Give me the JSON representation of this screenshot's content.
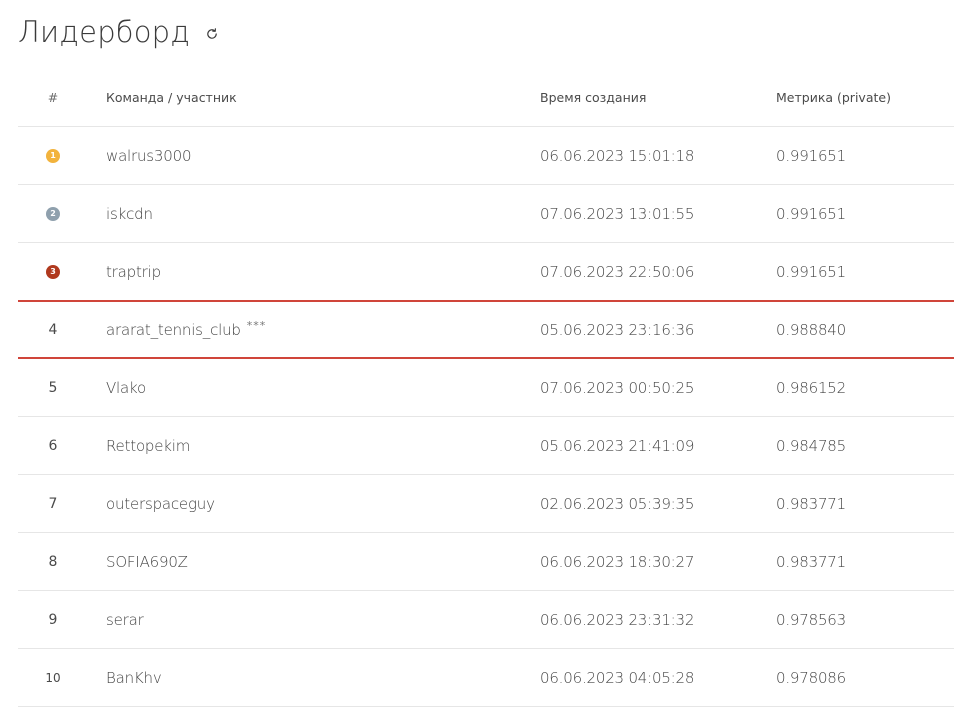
{
  "page": {
    "title": "Лидерборд",
    "refresh_icon": "refresh-icon"
  },
  "table": {
    "headers": {
      "rank": "#",
      "team": "Команда / участник",
      "time": "Время создания",
      "metric": "Метрика (private)"
    },
    "medal_colors": {
      "1": "#f2b33d",
      "2": "#8fa0ad",
      "3": "#b0391e"
    },
    "highlight_color": "#d0453a",
    "rows": [
      {
        "rank": "1",
        "team": "walrus3000",
        "time": "06.06.2023 15:01:18",
        "metric": "0.991651"
      },
      {
        "rank": "2",
        "team": "iskcdn",
        "time": "07.06.2023 13:01:55",
        "metric": "0.991651"
      },
      {
        "rank": "3",
        "team": "traptrip",
        "time": "07.06.2023 22:50:06",
        "metric": "0.991651"
      },
      {
        "rank": "4",
        "team": "ararat_tennis_club",
        "team_suffix": "***",
        "time": "05.06.2023 23:16:36",
        "metric": "0.988840"
      },
      {
        "rank": "5",
        "team": "Vlako",
        "time": "07.06.2023 00:50:25",
        "metric": "0.986152"
      },
      {
        "rank": "6",
        "team": "Rettopekim",
        "time": "05.06.2023 21:41:09",
        "metric": "0.984785"
      },
      {
        "rank": "7",
        "team": "outerspaceguy",
        "time": "02.06.2023 05:39:35",
        "metric": "0.983771"
      },
      {
        "rank": "8",
        "team": "SOFIA690Z",
        "time": "06.06.2023 18:30:27",
        "metric": "0.983771"
      },
      {
        "rank": "9",
        "team": "serar",
        "time": "06.06.2023 23:31:32",
        "metric": "0.978563"
      },
      {
        "rank": "10",
        "team": "BanKhv",
        "time": "06.06.2023 04:05:28",
        "metric": "0.978086"
      }
    ]
  }
}
